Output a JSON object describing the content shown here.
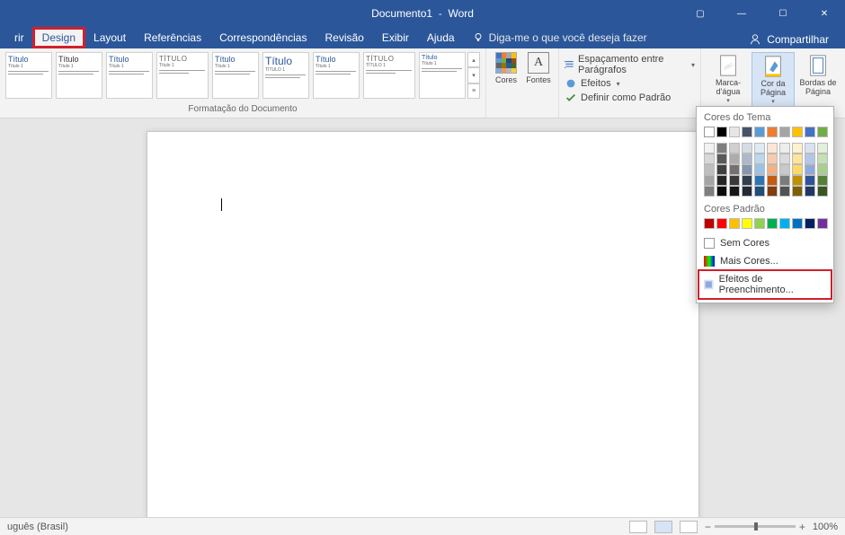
{
  "title": {
    "doc": "Documento1",
    "app": "Word"
  },
  "win": {
    "box": "▢",
    "min": "—",
    "max": "☐",
    "close": "✕"
  },
  "tabs": {
    "file_partial": "rir",
    "design": "Design",
    "layout": "Layout",
    "references": "Referências",
    "mailings": "Correspondências",
    "review": "Revisão",
    "view": "Exibir",
    "help": "Ajuda"
  },
  "tellme": "Diga-me o que você deseja fazer",
  "share": "Compartilhar",
  "ribbon": {
    "doc_format_group": "Formatação do Documento",
    "styles": [
      {
        "title": "Título",
        "sub": "Título 1"
      },
      {
        "title": "Título",
        "sub": "Título 1"
      },
      {
        "title": "Título",
        "sub": "Título 1"
      },
      {
        "title": "TÍTULO",
        "sub": "Título 1"
      },
      {
        "title": "Título",
        "sub": "Título 1"
      },
      {
        "title": "Título",
        "sub": "TÍTULO 1"
      },
      {
        "title": "Título",
        "sub": "Título 1"
      },
      {
        "title": "TÍTULO",
        "sub": "TÍTULO 1"
      },
      {
        "title": "Título",
        "sub": "Título 1"
      }
    ],
    "colors": "Cores",
    "fonts": "Fontes",
    "fonts_glyph": "A",
    "paragraph_spacing": "Espaçamento entre Parágrafos",
    "effects": "Efeitos",
    "set_default": "Definir como Padrão",
    "watermark": "Marca-d'água",
    "page_color": "Cor da Página",
    "page_borders": "Bordas de Página"
  },
  "dropdown": {
    "theme_heading": "Cores do Tema",
    "standard_heading": "Cores Padrão",
    "theme_colors_row1": [
      "#ffffff",
      "#000000",
      "#e7e6e6",
      "#44546a",
      "#5b9bd5",
      "#ed7d31",
      "#a5a5a5",
      "#ffc000",
      "#4472c4",
      "#70ad47"
    ],
    "theme_tints": [
      [
        "#f2f2f2",
        "#7f7f7f",
        "#d0cece",
        "#d6dce4",
        "#deebf6",
        "#fbe5d5",
        "#ededed",
        "#fff2cc",
        "#d9e2f3",
        "#e2efd9"
      ],
      [
        "#d8d8d8",
        "#595959",
        "#aeabab",
        "#adb9ca",
        "#bdd7ee",
        "#f7ccac",
        "#dbdbdb",
        "#fee599",
        "#b4c6e7",
        "#c5e0b3"
      ],
      [
        "#bfbfbf",
        "#3f3f3f",
        "#757070",
        "#8496b0",
        "#9cc3e5",
        "#f4b183",
        "#c9c9c9",
        "#ffd965",
        "#8eaadb",
        "#a8d08d"
      ],
      [
        "#a5a5a5",
        "#262626",
        "#3a3838",
        "#323f4f",
        "#2e75b5",
        "#c55a11",
        "#7b7b7b",
        "#bf9000",
        "#2f5496",
        "#538135"
      ],
      [
        "#7f7f7f",
        "#0c0c0c",
        "#171616",
        "#222a35",
        "#1e4e79",
        "#833c0b",
        "#525252",
        "#7f6000",
        "#1f3864",
        "#375623"
      ]
    ],
    "standard_colors": [
      "#c00000",
      "#ff0000",
      "#ffc000",
      "#ffff00",
      "#92d050",
      "#00b050",
      "#00b0f0",
      "#0070c0",
      "#002060",
      "#7030a0"
    ],
    "no_color": "Sem Cores",
    "more_colors": "Mais Cores...",
    "fill_effects": "Efeitos de Preenchimento..."
  },
  "status": {
    "lang_partial": "uguês (Brasil)",
    "zoom": "100%"
  }
}
